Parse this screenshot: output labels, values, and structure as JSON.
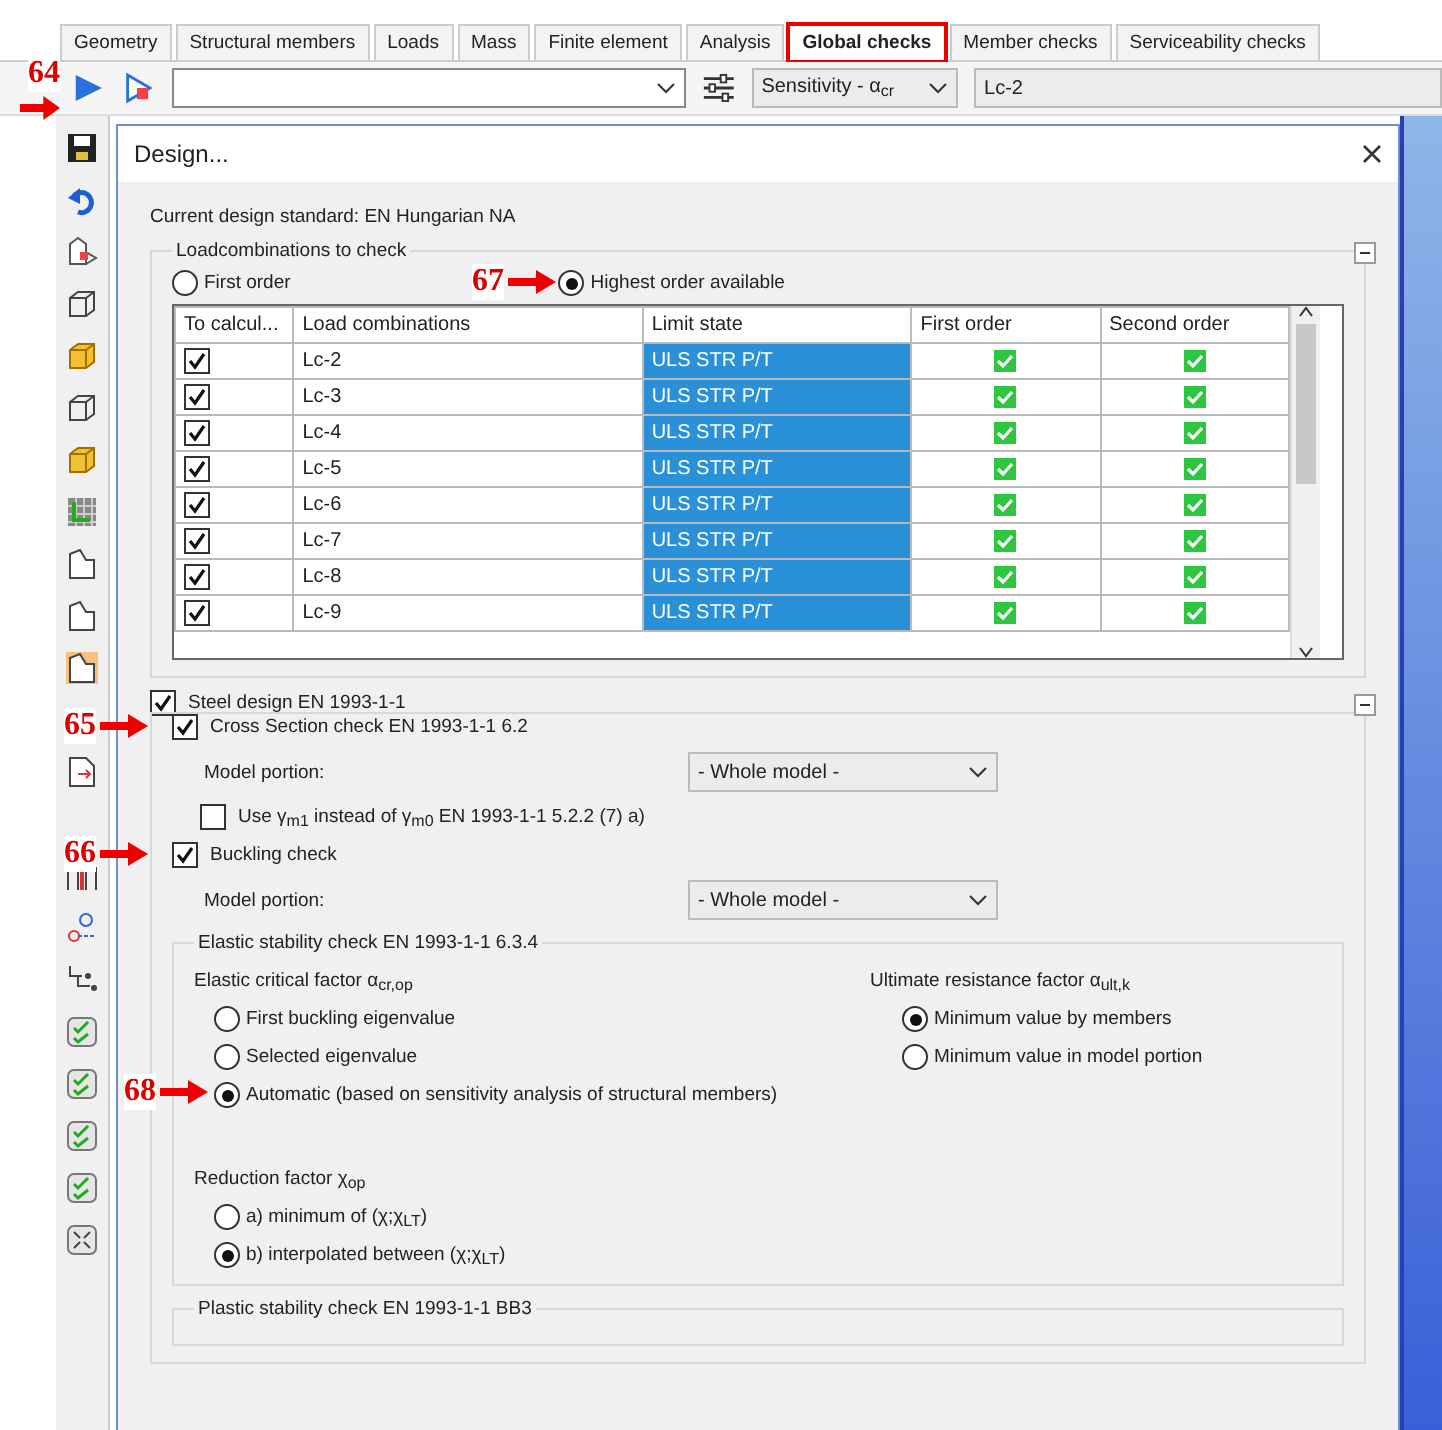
{
  "tabs": [
    {
      "label": "Geometry",
      "selected": false
    },
    {
      "label": "Structural members",
      "selected": false
    },
    {
      "label": "Loads",
      "selected": false
    },
    {
      "label": "Mass",
      "selected": false
    },
    {
      "label": "Finite element",
      "selected": false
    },
    {
      "label": "Analysis",
      "selected": false
    },
    {
      "label": "Global checks",
      "selected": true
    },
    {
      "label": "Member checks",
      "selected": false
    },
    {
      "label": "Serviceability checks",
      "selected": false
    }
  ],
  "toolbar": {
    "result_type": "Sensitivity - α$_{cr}$",
    "load_case": "Lc-2"
  },
  "callouts": [
    {
      "label": "64"
    },
    {
      "label": "65"
    },
    {
      "label": "66"
    },
    {
      "label": "67"
    },
    {
      "label": "68"
    }
  ],
  "dialog": {
    "title": "Design...",
    "standard": "Current design standard: EN Hungarian NA",
    "loadcombinations": {
      "title": "Loadcombinations to check",
      "options": [
        {
          "label": "First order",
          "selected": false
        },
        {
          "label": "Highest order available",
          "selected": true
        }
      ],
      "columns": [
        "To calcul...",
        "Load combinations",
        "Limit state",
        "First order",
        "Second order"
      ],
      "rows": [
        {
          "checked": true,
          "name": "Lc-2",
          "limit_state": "ULS STR P/T",
          "first": true,
          "second": true
        },
        {
          "checked": true,
          "name": "Lc-3",
          "limit_state": "ULS STR P/T",
          "first": true,
          "second": true
        },
        {
          "checked": true,
          "name": "Lc-4",
          "limit_state": "ULS STR P/T",
          "first": true,
          "second": true
        },
        {
          "checked": true,
          "name": "Lc-5",
          "limit_state": "ULS STR P/T",
          "first": true,
          "second": true
        },
        {
          "checked": true,
          "name": "Lc-6",
          "limit_state": "ULS STR P/T",
          "first": true,
          "second": true
        },
        {
          "checked": true,
          "name": "Lc-7",
          "limit_state": "ULS STR P/T",
          "first": true,
          "second": true
        },
        {
          "checked": true,
          "name": "Lc-8",
          "limit_state": "ULS STR P/T",
          "first": true,
          "second": true
        },
        {
          "checked": true,
          "name": "Lc-9",
          "limit_state": "ULS STR P/T",
          "first": true,
          "second": true
        }
      ]
    },
    "steel": {
      "label": "Steel design EN 1993-1-1",
      "checked": true,
      "cross_section": {
        "label": "Cross Section check EN 1993-1-1 6.2",
        "checked": true,
        "portion_label": "Model portion:",
        "portion": "- Whole model -",
        "gamma": {
          "label": "Use γ$_{m1}$ instead of γ$_{m0}$  EN 1993-1-1 5.2.2 (7) a)",
          "checked": false
        }
      },
      "buckling": {
        "label": "Buckling check",
        "checked": true,
        "portion_label": "Model portion:",
        "portion": "- Whole model -"
      },
      "elastic": {
        "title": "Elastic stability check EN 1993-1-1 6.3.4",
        "critical": {
          "label": "Elastic critical factor α$_{cr,op}$",
          "options": [
            {
              "label": "First buckling eigenvalue",
              "selected": false
            },
            {
              "label": "Selected eigenvalue",
              "selected": false
            },
            {
              "label": "Automatic (based on sensitivity analysis of structural members)",
              "selected": true
            }
          ]
        },
        "ultimate": {
          "label": "Ultimate resistance factor α$_{ult,k}$",
          "options": [
            {
              "label": "Minimum value by members",
              "selected": true
            },
            {
              "label": "Minimum value in model portion",
              "selected": false
            }
          ]
        },
        "reduction": {
          "label": "Reduction factor χ$_{op}$",
          "options": [
            {
              "label": "a) minimum of (χ;χ$_{LT}$)",
              "selected": false
            },
            {
              "label": "b) interpolated between (χ;χ$_{LT}$)",
              "selected": true
            }
          ]
        }
      },
      "plastic": {
        "title": "Plastic stability check EN 1993-1-1 BB3"
      }
    }
  }
}
